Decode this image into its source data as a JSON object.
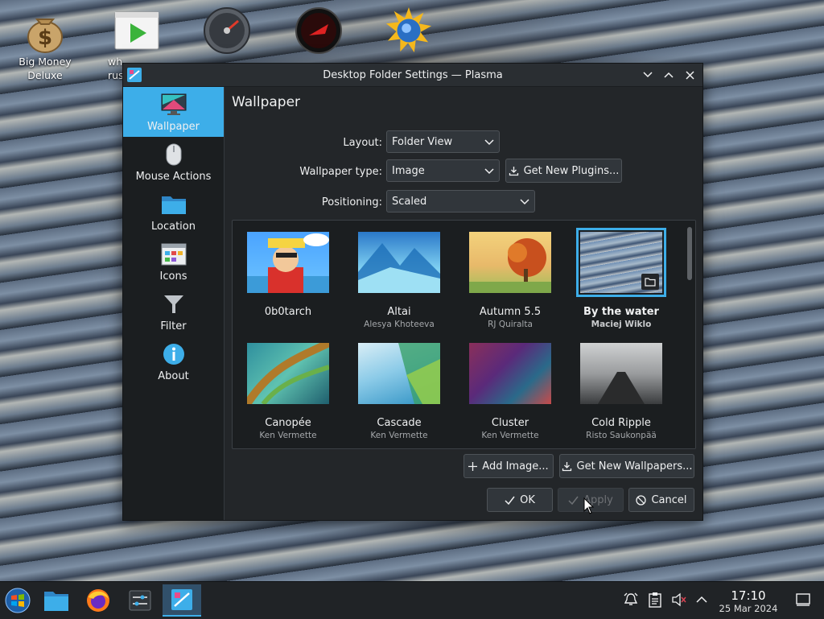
{
  "desktop": {
    "icons": [
      {
        "label": "Big Money Deluxe",
        "icon": "money-bag-icon"
      },
      {
        "label": "wh… russi…",
        "icon": "video-player-icon"
      },
      {
        "label": "",
        "icon": "speedometer-icon"
      },
      {
        "label": "",
        "icon": "red-gauge-icon"
      },
      {
        "label": "",
        "icon": "sun-globe-icon"
      }
    ]
  },
  "window": {
    "title": "Desktop Folder Settings — Plasma",
    "sidebar": [
      {
        "label": "Wallpaper",
        "icon": "monitor-icon",
        "active": true
      },
      {
        "label": "Mouse Actions",
        "icon": "mouse-icon"
      },
      {
        "label": "Location",
        "icon": "folder-icon"
      },
      {
        "label": "Icons",
        "icon": "icons-grid-icon"
      },
      {
        "label": "Filter",
        "icon": "filter-icon"
      },
      {
        "label": "About",
        "icon": "info-icon"
      }
    ],
    "page_title": "Wallpaper",
    "form": {
      "layout_label": "Layout:",
      "layout_value": "Folder View",
      "wallpaper_type_label": "Wallpaper type:",
      "wallpaper_type_value": "Image",
      "get_new_plugins": "Get New Plugins...",
      "positioning_label": "Positioning:",
      "positioning_value": "Scaled"
    },
    "wallpapers": [
      {
        "name": "0b0tarch",
        "author": "",
        "selected": false
      },
      {
        "name": "Altai",
        "author": "Alesya Khoteeva",
        "selected": false
      },
      {
        "name": "Autumn 5.5",
        "author": "RJ Quiralta",
        "selected": false
      },
      {
        "name": "By the water",
        "author": "Maciej Wiklo",
        "selected": true
      },
      {
        "name": "Canopée",
        "author": "Ken Vermette",
        "selected": false
      },
      {
        "name": "Cascade",
        "author": "Ken Vermette",
        "selected": false
      },
      {
        "name": "Cluster",
        "author": "Ken Vermette",
        "selected": false
      },
      {
        "name": "Cold Ripple",
        "author": "Risto Saukonpää",
        "selected": false
      }
    ],
    "buttons": {
      "add_image": "Add Image...",
      "get_new_wallpapers": "Get New Wallpapers...",
      "ok": "OK",
      "apply": "Apply",
      "cancel": "Cancel"
    }
  },
  "taskbar": {
    "apps": [
      "start-menu-icon",
      "file-manager-icon",
      "firefox-icon",
      "settings-icon",
      "plasma-settings-icon"
    ],
    "time": "17:10",
    "date": "25 Mar 2024"
  }
}
